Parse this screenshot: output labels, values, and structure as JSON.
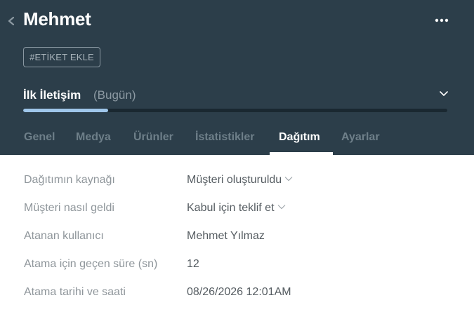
{
  "header": {
    "title": "Mehmet",
    "tag_button": "#ETİKET EKLE",
    "stage": {
      "name": "İlk İletişim",
      "date": "(Bugün)",
      "progress_percent": 20
    }
  },
  "tabs": [
    {
      "label": "Genel",
      "active": false
    },
    {
      "label": "Medya",
      "active": false
    },
    {
      "label": "Ürünler",
      "active": false
    },
    {
      "label": "İstatistikler",
      "active": false
    },
    {
      "label": "Dağıtım",
      "active": true
    },
    {
      "label": "Ayarlar",
      "active": false
    }
  ],
  "details": [
    {
      "label": "Dağıtımın kaynağı",
      "value": "Müşteri oluşturuldu",
      "dropdown": true
    },
    {
      "label": "Müşteri nasıl geldi",
      "value": "Kabul için teklif et",
      "dropdown": true
    },
    {
      "label": "Atanan kullanıcı",
      "value": "Mehmet Yılmaz",
      "dropdown": false
    },
    {
      "label": "Atama için geçen süre (sn)",
      "value": "12",
      "dropdown": false
    },
    {
      "label": "Atama tarihi ve saati",
      "value": "08/26/2026 12:01AM",
      "dropdown": false
    }
  ],
  "colors": {
    "header_bg": "#2c3e4a",
    "progress_fill": "#9fc6ea",
    "active_tab": "#ffffff",
    "inactive_tab": "#6e7f89"
  },
  "icons": {
    "back": "chevron-left-icon",
    "more": "more-horizontal-icon",
    "stage_expand": "chevron-down-icon",
    "dropdown": "chevron-down-icon"
  }
}
